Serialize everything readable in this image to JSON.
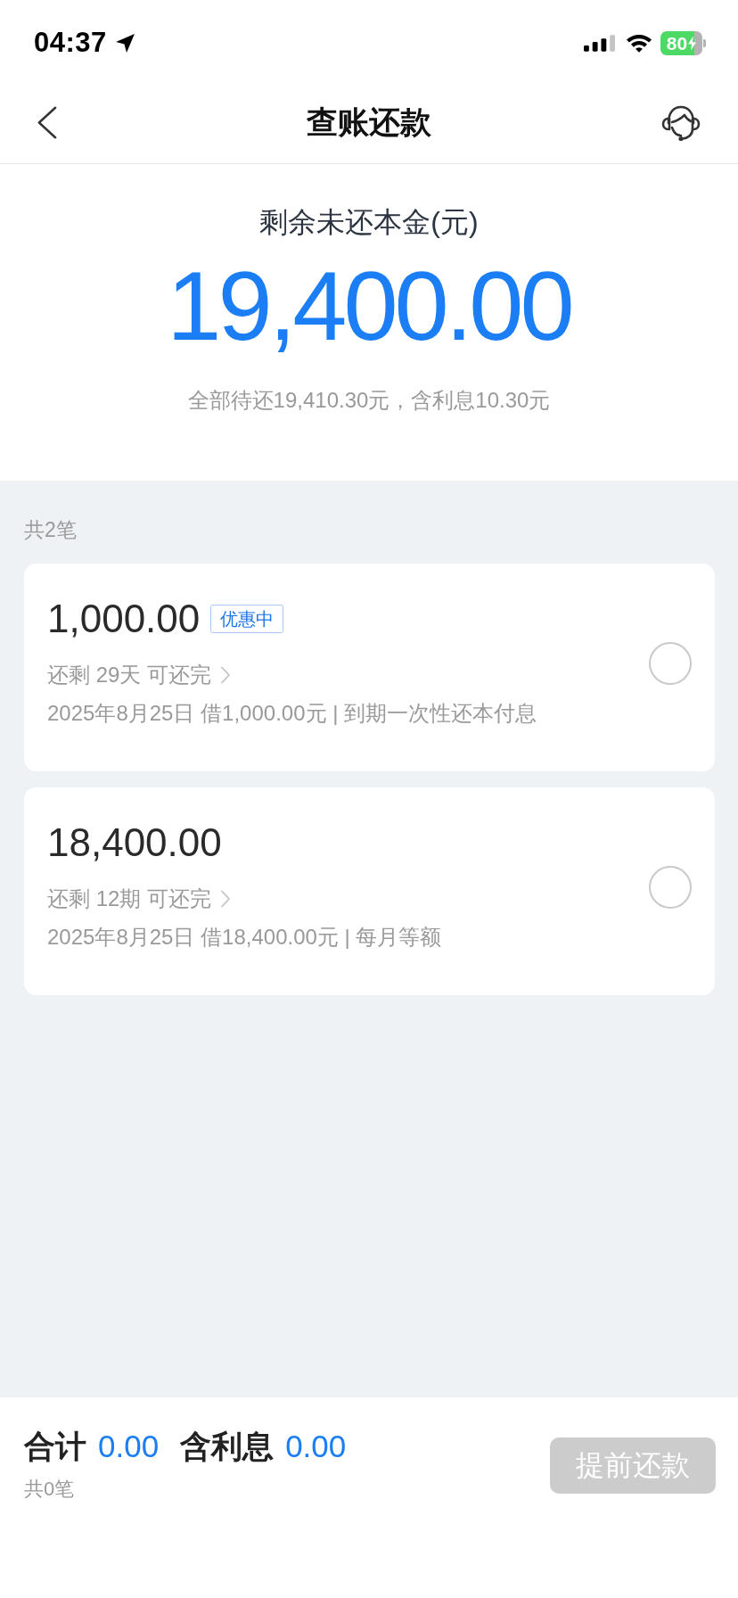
{
  "status_bar": {
    "time": "04:37",
    "battery": "80"
  },
  "nav": {
    "title": "查账还款"
  },
  "summary": {
    "label": "剩余未还本金(元)",
    "amount": "19,400.00",
    "note": "全部待还19,410.30元，含利息10.30元"
  },
  "loans": {
    "count": "共2笔",
    "items": [
      {
        "amount": "1,000.00",
        "badge": "优惠中",
        "remaining": "还剩 29天 可还完",
        "detail": "2025年8月25日 借1,000.00元 | 到期一次性还本付息",
        "selected": false
      },
      {
        "amount": "18,400.00",
        "remaining": "还剩 12期 可还完",
        "detail": "2025年8月25日 借18,400.00元 | 每月等额",
        "selected": false
      }
    ]
  },
  "footer": {
    "total_label": "合计",
    "total": "0.00",
    "interest_label": "含利息",
    "interest": "0.00",
    "count": "共0笔",
    "button": {
      "label": "提前还款",
      "disabled": true
    }
  }
}
